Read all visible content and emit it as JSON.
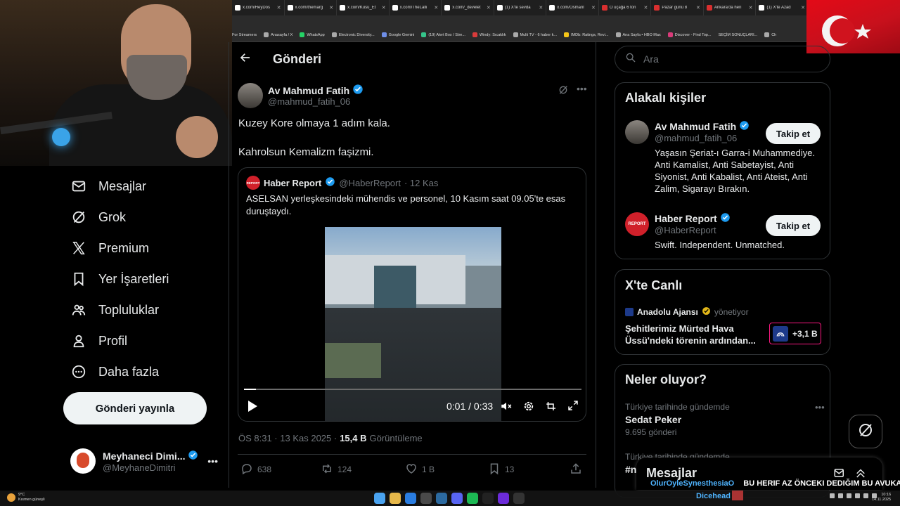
{
  "browser": {
    "tabs": [
      "x.com/HeyDos",
      "x.com/themarg",
      "x.com/Kusu_Et",
      "x.com/TheLalli",
      "x.com/_develet",
      "(1) X'te sevda",
      "x.com/Osmanl",
      "O uçağa 6 ton",
      "Pazar günü 8",
      "Ankara'da heri",
      "(1) X'te Azad"
    ],
    "bookmarks": [
      "For Streamers",
      "Anasayfa / X",
      "WhatsApp",
      "Electronic Diversity...",
      "Google Gemini",
      "(19) Alert Box / Stre...",
      "Windy: Sıcaklık",
      "Multi TV - 6 haber k...",
      "IMDb: Ratings, Revi...",
      "Ana Sayfa • HBO Max",
      "Discover - Find Top...",
      "SEÇİM SONUÇLARI...",
      "Ch"
    ]
  },
  "nav": {
    "items": [
      {
        "label": "Mesajlar",
        "icon": "mail-icon"
      },
      {
        "label": "Grok",
        "icon": "grok-icon"
      },
      {
        "label": "Premium",
        "icon": "x-logo-icon"
      },
      {
        "label": "Yer İşaretleri",
        "icon": "bookmark-icon"
      },
      {
        "label": "Topluluklar",
        "icon": "communities-icon"
      },
      {
        "label": "Profil",
        "icon": "profile-icon"
      },
      {
        "label": "Daha fazla",
        "icon": "more-circle-icon"
      }
    ],
    "post_button": "Gönderi yayınla",
    "account": {
      "name": "Meyhaneci Dimi...",
      "handle": "@MeyhaneDimitri"
    }
  },
  "main": {
    "title": "Gönderi",
    "author": {
      "name": "Av Mahmud Fatih",
      "handle": "@mahmud_fatih_06"
    },
    "text": [
      "Kuzey Kore olmaya 1 adım kala.",
      "Kahrolsun Kemalizm faşizmi."
    ],
    "quote": {
      "avatar_text": "REPORT",
      "name": "Haber Report",
      "handle": "@HaberReport",
      "date": "· 12 Kas",
      "text": "ASELSAN yerleşkesindeki mühendis ve personel, 10 Kasım saat 09.05'te esas duruştaydı.",
      "video_time": "0:01 / 0:33",
      "progress": 0.035
    },
    "meta": {
      "time": "ÖS 8:31 · 13 Kas 2025 ·",
      "views": "15,4 B",
      "views_label": "Görüntüleme"
    },
    "actions": {
      "replies": "638",
      "reposts": "124",
      "likes": "1 B",
      "bookmarks": "13"
    }
  },
  "right": {
    "search_placeholder": "Ara",
    "related": {
      "title": "Alakalı kişiler",
      "people": [
        {
          "name": "Av Mahmud Fatih",
          "handle": "@mahmud_fatih_06",
          "bio": "Yaşasın Şeriat-ı Garra-i Muhammediye. Anti Kamalist, Anti Sabetayist, Anti Siyonist, Anti Kabalist, Anti Ateist, Anti Zalim, Sigarayı Bırakın.",
          "follow": "Takip et"
        },
        {
          "name": "Haber Report",
          "handle": "@HaberReport",
          "bio": "Swift. Independent. Unmatched.",
          "follow": "Takip et",
          "avatar_text": "REPORT"
        }
      ]
    },
    "live": {
      "title": "X'te Canlı",
      "source": "Anadolu Ajansı",
      "role": "yönetiyor",
      "text": "Şehitlerimiz Mürted Hava Üssü'ndeki törenin ardından...",
      "count": "+3,1 B"
    },
    "trends": {
      "title": "Neler oluyor?",
      "items": [
        {
          "context": "Türkiye tarihinde gündemde",
          "name": "Sedat Peker",
          "count": "9.695 gönderi"
        },
        {
          "context": "Türkiye tarihinde gündemde",
          "name": "#n"
        }
      ]
    },
    "messages_dock": "Mesajlar"
  },
  "overlay": {
    "chat_user": "OlurOyleSynesthesiaO",
    "chat_message": "BU HERIF AZ ÖNCEKI DEDIĞIM BU AVUKAT",
    "streamer": "Dicehead"
  },
  "taskbar": {
    "weather_temp": "9°C",
    "weather_desc": "Kısmen güneşli",
    "time": "10:16",
    "date": "14.11.2025"
  },
  "colors": {
    "accent_verified": "#1d9bf0",
    "live_border": "#f91880",
    "flag_red": "#e30a17"
  }
}
